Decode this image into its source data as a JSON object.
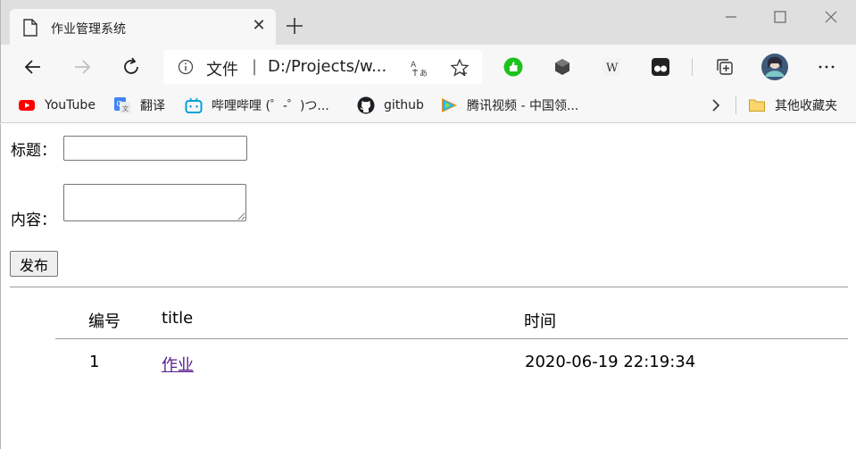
{
  "browser": {
    "tab_title": "作业管理系统",
    "tab_close_glyph": "✕",
    "address": {
      "label": "文件",
      "separator": "|",
      "url": "D:/Projects/w..."
    },
    "bookmarks": [
      {
        "label": "YouTube",
        "icon": "youtube-icon",
        "color": "#ff0000"
      },
      {
        "label": "翻译",
        "icon": "translate-icon",
        "color": "#4285f4"
      },
      {
        "label": "哔哩哔哩 (゜-゜)つ...",
        "icon": "bilibili-icon",
        "color": "#00a1d6"
      },
      {
        "label": "github",
        "icon": "github-icon",
        "color": "#1b1f23"
      },
      {
        "label": "腾讯视频 - 中国领...",
        "icon": "tencent-video-icon",
        "color": "#20b7f0"
      }
    ],
    "other_favorites": "其他收藏夹"
  },
  "form": {
    "title_label": "标题：",
    "title_value": "",
    "content_label": "内容：",
    "content_value": "",
    "submit_label": "发布"
  },
  "table": {
    "columns": [
      "编号",
      "title",
      "时间"
    ],
    "rows": [
      {
        "id": "1",
        "title": "作业",
        "time": "2020-06-19 22:19:34"
      }
    ]
  }
}
